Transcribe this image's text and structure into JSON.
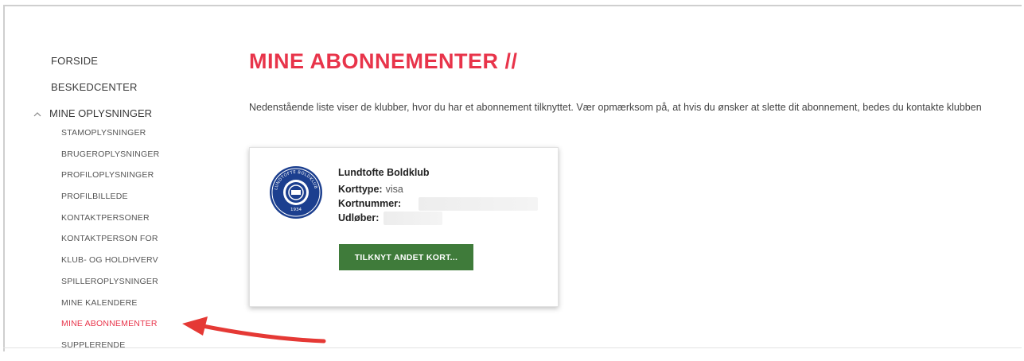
{
  "sidebar": {
    "top_items": [
      {
        "label": "FORSIDE"
      },
      {
        "label": "BESKEDCENTER"
      }
    ],
    "group": {
      "label": "MINE OPLYSNINGER",
      "expanded_icon": "chevron-up-icon",
      "items": [
        {
          "label": "STAMOPLYSNINGER"
        },
        {
          "label": "BRUGEROPLYSNINGER"
        },
        {
          "label": "PROFILOPLYSNINGER"
        },
        {
          "label": "PROFILBILLEDE"
        },
        {
          "label": "KONTAKTPERSONER"
        },
        {
          "label": "KONTAKTPERSON FOR"
        },
        {
          "label": "KLUB- OG HOLDHVERV"
        },
        {
          "label": "SPILLEROPLYSNINGER"
        },
        {
          "label": "MINE KALENDERE"
        },
        {
          "label": "MINE ABONNEMENTER",
          "active": true
        },
        {
          "label": "SUPPLERENDE"
        }
      ]
    }
  },
  "main": {
    "title": "MINE ABONNEMENTER //",
    "intro": "Nedenstående liste viser de klubber, hvor du har et abonnement tilknyttet. Vær opmærksom på, at hvis du ønsker at slette dit abonnement, bedes du kontakte klubben",
    "card": {
      "club_name": "Lundtofte Boldklub",
      "logo_icon": "club-crest-icon",
      "logo_text": "LUNDTOFTE BOLDKLUB",
      "logo_year": "1934",
      "card_type_label": "Korttype:",
      "card_type_value": "visa",
      "card_number_label": "Kortnummer:",
      "expires_label": "Udløber:",
      "button_label": "TILKNYT ANDET KORT..."
    }
  },
  "colors": {
    "accent": "#e8344a",
    "button": "#3f7b3a",
    "logo_blue": "#1c3f8f",
    "arrow": "#e53935"
  }
}
